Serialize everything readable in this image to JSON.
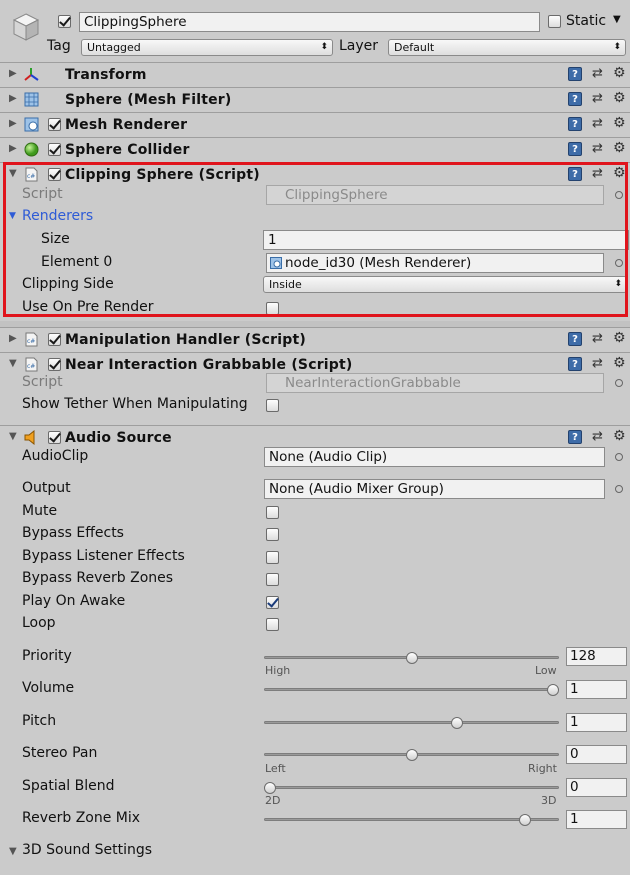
{
  "header": {
    "object_name": "ClippingSphere",
    "static_label": "Static",
    "tag_label": "Tag",
    "tag_value": "Untagged",
    "layer_label": "Layer",
    "layer_value": "Default"
  },
  "components": {
    "transform": "Transform",
    "mesh_filter": "Sphere (Mesh Filter)",
    "mesh_renderer": "Mesh Renderer",
    "sphere_collider": "Sphere Collider",
    "clipping_sphere": "Clipping Sphere (Script)",
    "manipulation_handler": "Manipulation Handler (Script)",
    "near_interaction": "Near Interaction Grabbable (Script)",
    "audio_source": "Audio Source",
    "sound3d": "3D Sound Settings"
  },
  "clipping": {
    "script_label": "Script",
    "script_value": "ClippingSphere",
    "renderers_label": "Renderers",
    "size_label": "Size",
    "size_value": "1",
    "element0_label": "Element 0",
    "element0_value": "node_id30 (Mesh Renderer)",
    "side_label": "Clipping Side",
    "side_value": "Inside",
    "pre_render_label": "Use On Pre Render"
  },
  "near": {
    "script_label": "Script",
    "script_value": "NearInteractionGrabbable",
    "tether_label": "Show Tether When Manipulating"
  },
  "audio": {
    "clip_label": "AudioClip",
    "clip_value": "None (Audio Clip)",
    "output_label": "Output",
    "output_value": "None (Audio Mixer Group)",
    "mute_label": "Mute",
    "bypass_effects_label": "Bypass Effects",
    "bypass_listener_label": "Bypass Listener Effects",
    "bypass_reverb_label": "Bypass Reverb Zones",
    "play_on_awake_label": "Play On Awake",
    "loop_label": "Loop",
    "priority_label": "Priority",
    "priority_value": "128",
    "priority_fraction": 0.5,
    "priority_min": "High",
    "priority_max": "Low",
    "volume_label": "Volume",
    "volume_value": "1",
    "volume_fraction": 1.0,
    "pitch_label": "Pitch",
    "pitch_value": "1",
    "pitch_fraction": 0.66,
    "stereo_label": "Stereo Pan",
    "stereo_value": "0",
    "stereo_fraction": 0.5,
    "stereo_min": "Left",
    "stereo_max": "Right",
    "spatial_label": "Spatial Blend",
    "spatial_value": "0",
    "spatial_fraction": 0.0,
    "spatial_min": "2D",
    "spatial_max": "3D",
    "reverb_mix_label": "Reverb Zone Mix",
    "reverb_mix_value": "1",
    "reverb_mix_fraction": 0.9
  },
  "colors": {
    "highlight": "#e0141c",
    "renderers_blue": "#2e5bd6"
  }
}
